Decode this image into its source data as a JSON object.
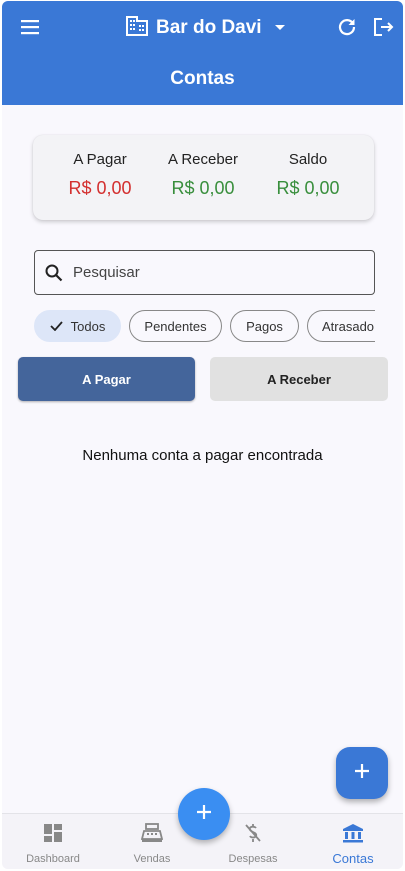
{
  "appbar": {
    "business_name": "Bar do Davi",
    "page_title": "Contas"
  },
  "summary": {
    "pagar_label": "A Pagar",
    "pagar_value": "R$ 0,00",
    "receber_label": "A Receber",
    "receber_value": "R$ 0,00",
    "saldo_label": "Saldo",
    "saldo_value": "R$ 0,00"
  },
  "search": {
    "placeholder": "Pesquisar",
    "value": ""
  },
  "filters": {
    "items": [
      "Todos",
      "Pendentes",
      "Pagos",
      "Atrasado"
    ],
    "selected": "Todos"
  },
  "tabs": {
    "pagar": "A Pagar",
    "receber": "A Receber",
    "active": "A Pagar"
  },
  "empty_message": "Nenhuma conta a pagar encontrada",
  "bottom_nav": {
    "items": [
      {
        "label": "Dashboard",
        "icon": "dashboard-icon"
      },
      {
        "label": "Vendas",
        "icon": "cash-register-icon"
      },
      {
        "label": "Despesas",
        "icon": "money-off-icon"
      },
      {
        "label": "Contas",
        "icon": "bank-icon"
      }
    ],
    "active": "Contas"
  },
  "colors": {
    "primary": "#3a78d6",
    "negative": "#d32f2f",
    "positive": "#388e3c",
    "active_tab": "#44659b"
  }
}
